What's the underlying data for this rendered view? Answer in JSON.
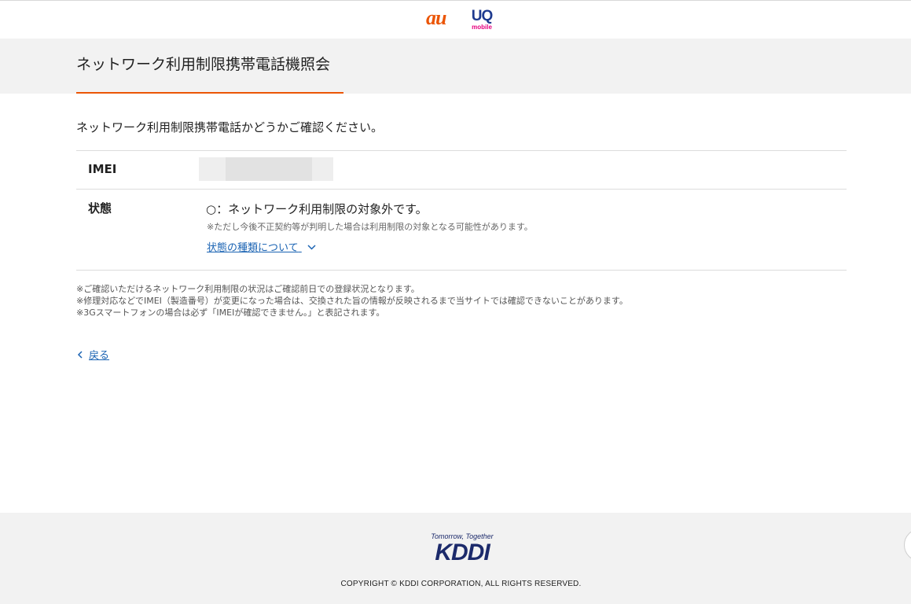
{
  "brand": {
    "au": "au",
    "uq": "UQ",
    "uq_sub": "mobile"
  },
  "header": {
    "title": "ネットワーク利用制限携帯電話機照会"
  },
  "main": {
    "lead": "ネットワーク利用制限携帯電話かどうかご確認ください。",
    "imei": {
      "label": "IMEI"
    },
    "status": {
      "label": "状態",
      "value": "○：ネットワーク利用制限の対象外です。",
      "note": "※ただし今後不正契約等が判明した場合は利用制限の対象となる可能性があります。",
      "types_link": "状態の種類について"
    },
    "notes": [
      "※ご確認いただけるネットワーク利用制限の状況はご確認前日での登録状況となります。",
      "※修理対応などでIMEI（製造番号）が変更になった場合は、交換された旨の情報が反映されるまで当サイトでは確認できないことがあります。",
      "※3Gスマートフォンの場合は必ず「IMEIが確認できません。」と表記されます。"
    ],
    "back_link": "戻る"
  },
  "footer": {
    "tagline": "Tomorrow, Together",
    "logo": "KDDI",
    "copyright": "COPYRIGHT © KDDI CORPORATION, ALL RIGHTS RESERVED."
  },
  "colors": {
    "accent": "#eb5505",
    "link": "#1a63b3",
    "kddi_navy": "#1c2a6b",
    "uq_magenta": "#e6007e"
  }
}
